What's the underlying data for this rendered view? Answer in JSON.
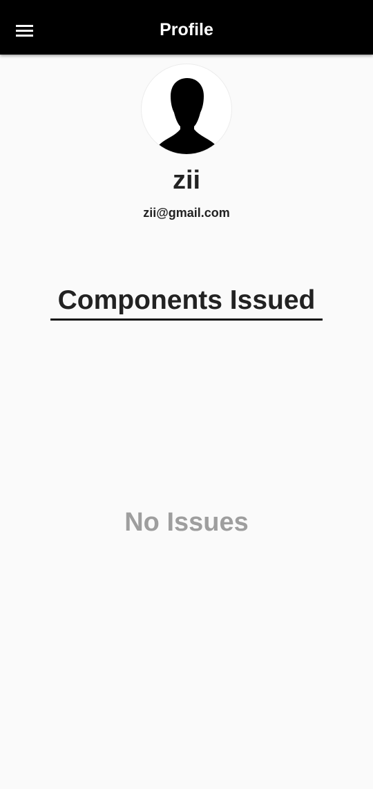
{
  "app_bar": {
    "title": "Profile",
    "menu_icon": "hamburger-menu-icon",
    "background": "#000000",
    "text_color": "#ffffff"
  },
  "profile": {
    "avatar_icon": "person-silhouette-icon",
    "name": "zii",
    "email": "zii@gmail.com"
  },
  "components": {
    "section_title": "Components Issued",
    "empty_message": "No Issues",
    "empty_color": "#9e9e9e"
  }
}
